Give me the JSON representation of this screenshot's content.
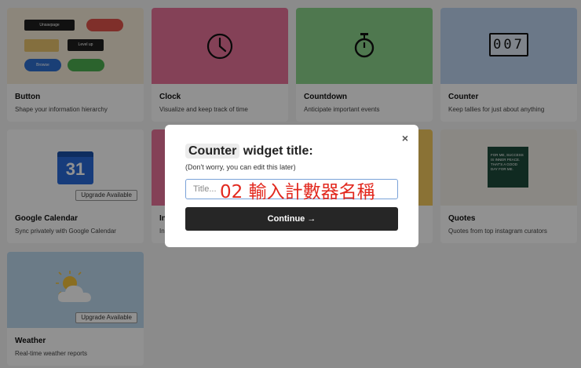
{
  "cards": [
    {
      "title": "Button",
      "desc": "Shape your information hierarchy"
    },
    {
      "title": "Clock",
      "desc": "Visualize and keep track of time"
    },
    {
      "title": "Countdown",
      "desc": "Anticipate important events"
    },
    {
      "title": "Counter",
      "desc": "Keep tallies for just about anything"
    },
    {
      "title": "Google Calendar",
      "desc": "Sync privately with Google Calendar",
      "badge": "Upgrade Available",
      "icon_text": "31"
    },
    {
      "title": "In",
      "desc": "In"
    },
    {
      "title": "Quotes",
      "desc": "Quotes from top instagram curators",
      "quote": "FOR ME, SUCCESS IS INNER PEACE. THAT'S A GOOD DAY FOR ME."
    },
    {
      "title": "Weather",
      "desc": "Real-time weather reports",
      "badge": "Upgrade Available"
    }
  ],
  "button_thumb": {
    "pill1": "Unsavpage",
    "pill3": "Level up",
    "pill4": "Browse"
  },
  "counter_digits": "007",
  "modal": {
    "widget_name": "Counter",
    "heading_rest": "widget title:",
    "subtitle": "(Don't worry, you can edit this later)",
    "input_placeholder": "Title...",
    "annotation": "02 輸入計數器名稱",
    "continue_label": "Continue →",
    "close_label": "×"
  },
  "colors": {
    "button_bg": "#f6ecd9",
    "clock_bg": "#e8739a",
    "countdown_bg": "#8bd48c",
    "counter_bg": "#bcd4ef",
    "calendar_bg": "#ffffff",
    "quotes_bg": "#f3f0e8",
    "weather_bg": "#bdd8ee",
    "modal_button": "#262626",
    "annotation": "#e2281e"
  }
}
